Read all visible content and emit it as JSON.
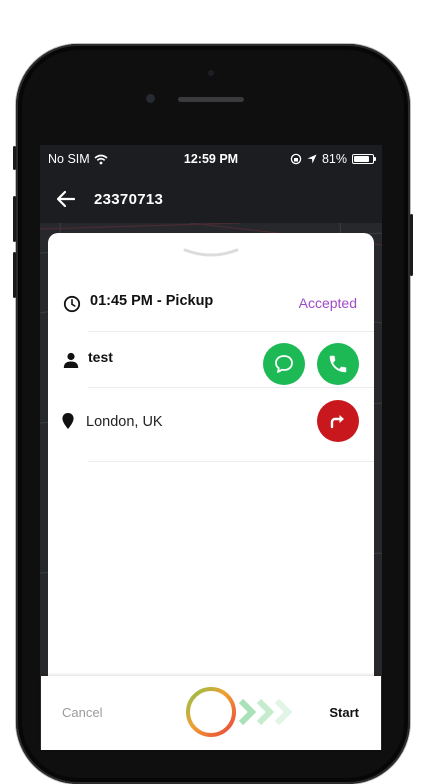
{
  "status_bar": {
    "carrier": "No SIM",
    "time": "12:59 PM",
    "battery_percent": "81%",
    "battery_level": 0.81
  },
  "header": {
    "title": "23370713",
    "back_icon": "arrow-left-icon"
  },
  "job": {
    "pickup_time": "01:45 PM - Pickup",
    "status": "Accepted",
    "customer_name": "test",
    "address": "London, UK"
  },
  "actions": {
    "cancel_label": "Cancel",
    "start_label": "Start"
  },
  "colors": {
    "status_accent": "#a14ac8",
    "message_green": "#1db954",
    "call_green": "#1db954",
    "navigate_red": "#c8181e",
    "screen_dark": "#1c1d20"
  },
  "icons": {
    "time": "clock-icon",
    "person": "person-icon",
    "location": "location-pin-icon",
    "message": "chat-bubble-icon",
    "call": "phone-icon",
    "navigate": "turn-right-arrow-icon"
  }
}
